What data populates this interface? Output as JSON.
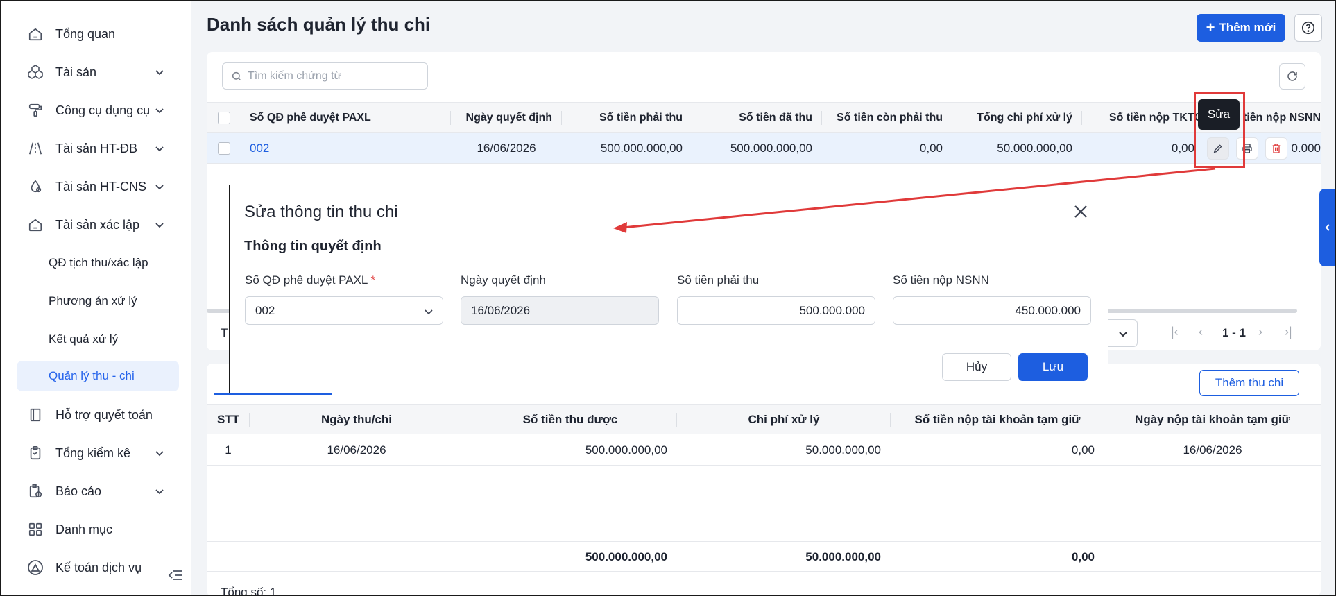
{
  "sidebar": {
    "items": [
      {
        "label": "Tổng quan",
        "icon": "home-icon"
      },
      {
        "label": "Tài sản",
        "icon": "boxes-icon"
      },
      {
        "label": "Công cụ dụng cụ",
        "icon": "paint-roller-icon"
      },
      {
        "label": "Tài sản HT-ĐB",
        "icon": "road-icon"
      },
      {
        "label": "Tài sản HT-CNS",
        "icon": "water-drop-icon"
      },
      {
        "label": "Tài sản xác lập",
        "icon": "home-icon"
      },
      {
        "label": "QĐ tịch thu/xác lập"
      },
      {
        "label": "Phương án xử lý"
      },
      {
        "label": "Kết quả xử lý"
      },
      {
        "label": "Quản lý thu - chi"
      },
      {
        "label": "Hỗ trợ quyết toán",
        "icon": "book-icon"
      },
      {
        "label": "Tổng kiểm kê",
        "icon": "clipboard-icon"
      },
      {
        "label": "Báo cáo",
        "icon": "report-icon"
      },
      {
        "label": "Danh mục",
        "icon": "grid-icon"
      },
      {
        "label": "Kế toán dịch vụ",
        "icon": "triangle-logo-icon"
      }
    ]
  },
  "header": {
    "title": "Danh sách quản lý thu chi",
    "add_label": "Thêm mới"
  },
  "search": {
    "placeholder": "Tìm kiếm chứng từ"
  },
  "table": {
    "columns": [
      "Số QĐ phê duyệt PAXL",
      "Ngày quyết định",
      "Số tiền phải thu",
      "Số tiền đã thu",
      "Số tiền còn phải thu",
      "Tổng chi phí xử lý",
      "Số tiền nộp TKTG",
      "Số tiền nộp NSNN"
    ],
    "rows": [
      {
        "so_qd": "002",
        "ngay": "16/06/2026",
        "phai_thu": "500.000.000,00",
        "da_thu": "500.000.000,00",
        "con_phai_thu": "0,00",
        "chi_phi": "50.000.000,00",
        "tktg": "0,00",
        "nsnn": "0.000"
      }
    ],
    "tooltip": "Sửa"
  },
  "pager": {
    "total_prefix": "T",
    "range": "1 - 1"
  },
  "detail": {
    "add_button": "Thêm thu chi",
    "columns": [
      "STT",
      "Ngày thu/chi",
      "Số tiền thu được",
      "Chi phí xử lý",
      "Số tiền nộp tài khoản tạm giữ",
      "Ngày nộp tài khoản tạm giữ"
    ],
    "rows": [
      {
        "stt": "1",
        "ngay": "16/06/2026",
        "thu_duoc": "500.000.000,00",
        "chi_phi": "50.000.000,00",
        "nop_tg": "0,00",
        "ngay_nop": "16/06/2026"
      }
    ],
    "sum": {
      "thu_duoc": "500.000.000,00",
      "chi_phi": "50.000.000,00",
      "nop_tg": "0,00"
    },
    "total_count": "Tổng số: 1"
  },
  "modal": {
    "title": "Sửa thông tin thu chi",
    "section": "Thông tin quyết định",
    "fields": [
      {
        "label": "Số QĐ phê duyệt PAXL",
        "required": "*",
        "value": "002"
      },
      {
        "label": "Ngày quyết định",
        "value": "16/06/2026"
      },
      {
        "label": "Số tiền phải thu",
        "value": "500.000.000"
      },
      {
        "label": "Số tiền nộp NSNN",
        "value": "450.000.000"
      }
    ],
    "cancel": "Hủy",
    "save": "Lưu"
  },
  "colors": {
    "primary": "#1d5ee0",
    "annotation": "#e03a3a"
  }
}
